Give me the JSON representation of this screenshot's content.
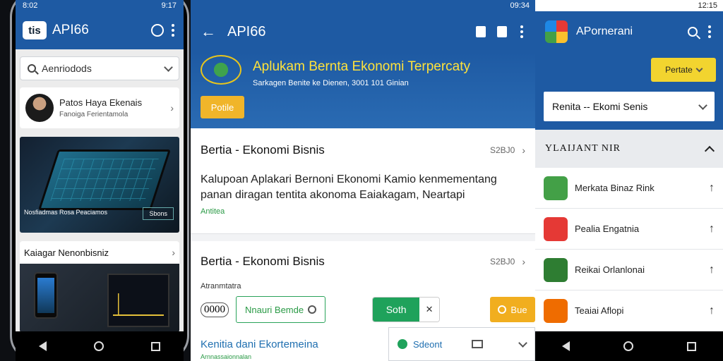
{
  "left_phone": {
    "status": {
      "left": "8:02",
      "right": "9:17"
    },
    "logo": "tis",
    "app_title": "API66",
    "search_label": "Aenriodods",
    "news": {
      "title": "Patos Haya Ekenais",
      "subtitle": "Fanoiga Ferientamola"
    },
    "banner": {
      "caption": "Nosfiadmas Rosa Peaciamos",
      "button": "Sbons"
    },
    "card": {
      "title": "Kaiagar Nenonbisniz"
    }
  },
  "middle": {
    "status_time": "09:34",
    "app_title": "API66",
    "hero": {
      "headline": "Aplukam Bernta Ekonomi Terpercaty",
      "subline": "Sarkagen Benite ke Dienen, 3001 101 Ginian",
      "button": "Potile"
    },
    "section1": {
      "title": "Bertia - Ekonomi Bisnis",
      "meta": "S2BJ0",
      "body": "Kalupoan Aplakari Bernoni Ekonomi Kamio kenmementang panan diragan tentita akonoma Eaiakagam, Neartapi",
      "tag": "Antitea"
    },
    "section2": {
      "title": "Bertia - Ekonomi Bisnis",
      "meta": "S2BJ0",
      "subtitle": "Atranmtatra",
      "pill": "0000",
      "outline_button": "Nnauri Bemde",
      "green_button": "Soth",
      "yellow_button": "Bue"
    },
    "section3": {
      "title": "Kenitia dani Ekortemeina",
      "subtitle": "Arnnassaionnalan"
    },
    "dropdown": {
      "label": "Sdeont"
    }
  },
  "right": {
    "status_time": "12:15",
    "app_title": "APornerani",
    "filter_button": "Pertate",
    "select_value": "Renita -- Ekomi Senis",
    "accordion_title": "YLAIJANT NIR",
    "items": [
      {
        "label": "Merkata Binaz Rink",
        "color": "#43a047"
      },
      {
        "label": "Pealia Engatnia",
        "color": "#e53935"
      },
      {
        "label": "Reikai Orlanlonai",
        "color": "#2e7d32"
      },
      {
        "label": "Teaiai Aflopi",
        "color": "#ef6c00"
      }
    ]
  },
  "colors": {
    "primary": "#1e5aa3",
    "accent_yellow": "#f2d42f",
    "green": "#1fa25b",
    "orange": "#f1ae1f"
  }
}
